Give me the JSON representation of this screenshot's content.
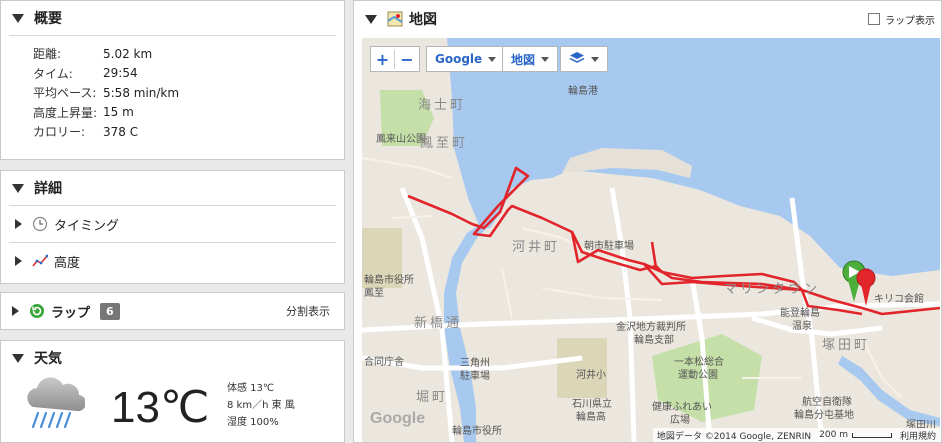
{
  "summary": {
    "title": "概要",
    "stats": [
      {
        "label": "距離:",
        "value": "5.02 km"
      },
      {
        "label": "タイム:",
        "value": "29:54"
      },
      {
        "label": "平均ペース:",
        "value": "5:58 min/km"
      },
      {
        "label": "高度上昇量:",
        "value": "15 m"
      },
      {
        "label": "カロリー:",
        "value": "378 C"
      }
    ]
  },
  "details": {
    "title": "詳細",
    "items": [
      {
        "label": "タイミング",
        "icon": "clock-icon"
      },
      {
        "label": "高度",
        "icon": "elevation-chart-icon"
      }
    ]
  },
  "laps": {
    "title": "ラップ",
    "count": "6",
    "split_label": "分割表示"
  },
  "weather": {
    "title": "天気",
    "temperature": "13℃",
    "feels_like": "体感 13℃",
    "wind": "8 km／h 東 風",
    "humidity": "湿度 100%",
    "icon": "rain-cloud-icon"
  },
  "map": {
    "title": "地図",
    "laps_checkbox_label": "ラップ表示",
    "controls": {
      "zoom_in": "+",
      "zoom_out": "−",
      "provider": "Google",
      "map_type": "地図",
      "layers_icon": "layers-icon"
    },
    "labels": {
      "wajima_port": "輪島港",
      "kaishi": "海士町",
      "houraiyama": "鳳来山公園",
      "houshi": "鳳至町",
      "kawai": "河井町",
      "asaichi_parking": "朝市駐車場",
      "marintown": "マリンタウン",
      "city_hall": "輪島市役所",
      "city_hall2": "鳳至",
      "shinbashi": "新橋通",
      "kanazawa_court": "金沢地方裁判所",
      "kanazawa_court2": "輪島支部",
      "noto_onsen": "能登輪島",
      "onsen": "温泉",
      "kiriko": "キリコ会館",
      "tsukada": "塚田町",
      "joint_office": "合同庁舎",
      "sankakusu": "三角州",
      "sankakusu2": "駐車場",
      "kawai_school": "河井小",
      "ipponmatsu": "一本松総合",
      "ipponmatsu2": "運動公園",
      "hori": "堀町",
      "wajima_high": "石川県立",
      "wajima_high2": "輪島高",
      "city_office": "輪島市役所",
      "fureai": "健康ふれあい",
      "fureai2": "広場",
      "jsdf": "航空自衛隊",
      "jsdf2": "輪島分屯基地",
      "tsukada_river": "塚田川",
      "google_logo": "Google"
    },
    "attribution": "地図データ ©2014 Google, ZENRIN",
    "scale": "200 m",
    "terms": "利用規約"
  },
  "colors": {
    "route": "#e2252b",
    "water": "#a7c8ef",
    "land": "#ebe7de",
    "park": "#c5dfa8"
  }
}
